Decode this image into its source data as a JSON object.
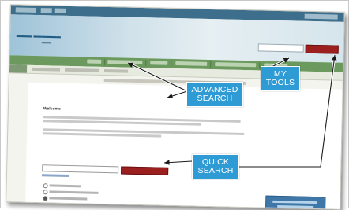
{
  "callouts": {
    "advanced_search": "ADVANCED\nSEARCH",
    "my_tools": "MY\nTOOLS",
    "quick_search": "QUICK\nSEARCH"
  },
  "page": {
    "welcome_heading": "Welcome"
  },
  "colors": {
    "callout_bg": "#2e9bd4",
    "button_red": "#9c1f1f",
    "nav_green": "#6c9a5e",
    "header_blue": "#9fc3d8"
  }
}
